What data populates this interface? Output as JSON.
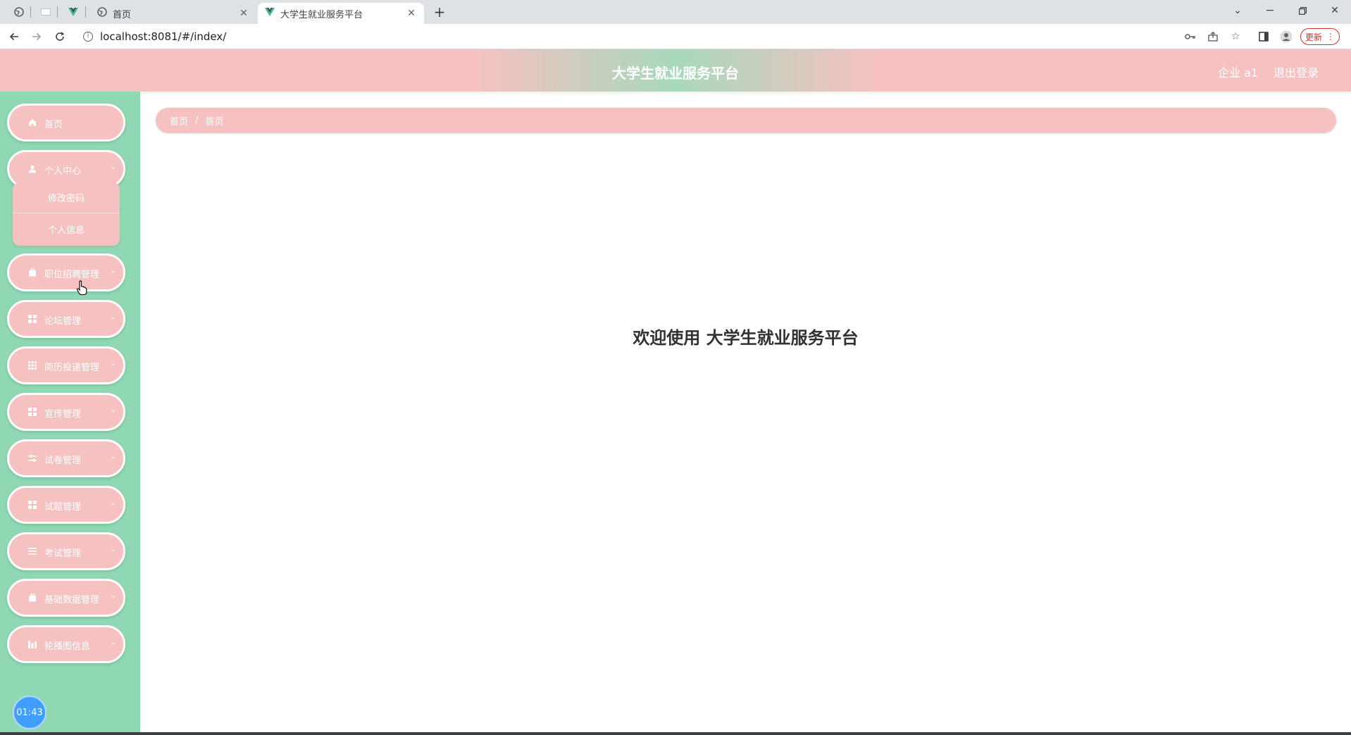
{
  "browser": {
    "tabs": [
      {
        "title": "首页",
        "icon": "globe-icon",
        "active": false
      },
      {
        "title": "大学生就业服务平台",
        "icon": "vue-logo-icon",
        "active": true
      }
    ],
    "new_tab_icon": "plus-icon",
    "url": "localhost:8081/#/index/",
    "update_label": "更新"
  },
  "header": {
    "title": "大学生就业服务平台",
    "user": "企业 a1",
    "logout": "退出登录"
  },
  "sidebar": {
    "items": [
      {
        "label": "首页",
        "icon": "home-icon",
        "has_arrow": false
      },
      {
        "label": "个人中心",
        "icon": "user-icon",
        "has_arrow": true
      },
      {
        "label": "职位招聘管理",
        "icon": "briefcase-icon",
        "has_arrow": true
      },
      {
        "label": "论坛管理",
        "icon": "grid-icon",
        "has_arrow": true
      },
      {
        "label": "简历投递管理",
        "icon": "table-icon",
        "has_arrow": true
      },
      {
        "label": "宣传管理",
        "icon": "grid-icon",
        "has_arrow": true
      },
      {
        "label": "试卷管理",
        "icon": "sliders-icon",
        "has_arrow": true
      },
      {
        "label": "试题管理",
        "icon": "grid-icon",
        "has_arrow": true
      },
      {
        "label": "考试管理",
        "icon": "list-icon",
        "has_arrow": true
      },
      {
        "label": "基础数据管理",
        "icon": "briefcase-icon",
        "has_arrow": true
      },
      {
        "label": "轮播图信息",
        "icon": "chart-icon",
        "has_arrow": true
      }
    ],
    "submenu": [
      "修改密码",
      "个人信息"
    ],
    "clock": "01:43"
  },
  "breadcrumb": [
    "首页",
    "首页"
  ],
  "main": {
    "welcome": "欢迎使用 大学生就业服务平台"
  },
  "colors": {
    "sidebar_bg": "#8fd8b3",
    "accent_pink": "#f6c1c1",
    "clock_blue": "#409eff"
  }
}
